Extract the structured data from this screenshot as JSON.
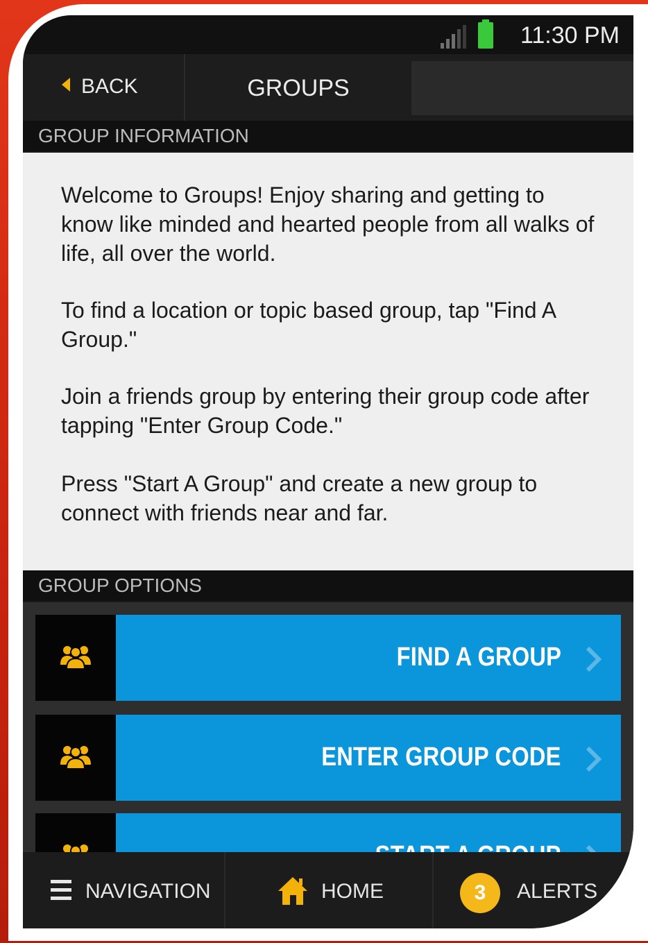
{
  "status_bar": {
    "time": "11:30 PM"
  },
  "header": {
    "back_label": "BACK",
    "title": "GROUPS"
  },
  "group_information": {
    "heading": "GROUP INFORMATION",
    "paragraphs": [
      "Welcome to Groups!  Enjoy sharing and getting to know like minded and hearted people from all walks of life, all over the world.",
      "To find a location or topic based group, tap \"Find A Group.\"",
      "Join a friends group by entering their group code after tapping \"Enter Group Code.\"",
      "Press \"Start A Group\" and create a new group to connect with friends near and far."
    ]
  },
  "group_options": {
    "heading": "GROUP OPTIONS",
    "items": [
      {
        "label": "FIND A GROUP",
        "icon": "group-icon"
      },
      {
        "label": "ENTER GROUP CODE",
        "icon": "group-icon"
      },
      {
        "label": "START A GROUP",
        "icon": "group-icon"
      }
    ]
  },
  "bottom_nav": {
    "navigation_label": "NAVIGATION",
    "home_label": "HOME",
    "alerts_label": "ALERTS",
    "alerts_count": "3"
  },
  "colors": {
    "accent_blue": "#0b95db",
    "accent_yellow": "#f2b20a",
    "frame_red": "#d42a12"
  }
}
